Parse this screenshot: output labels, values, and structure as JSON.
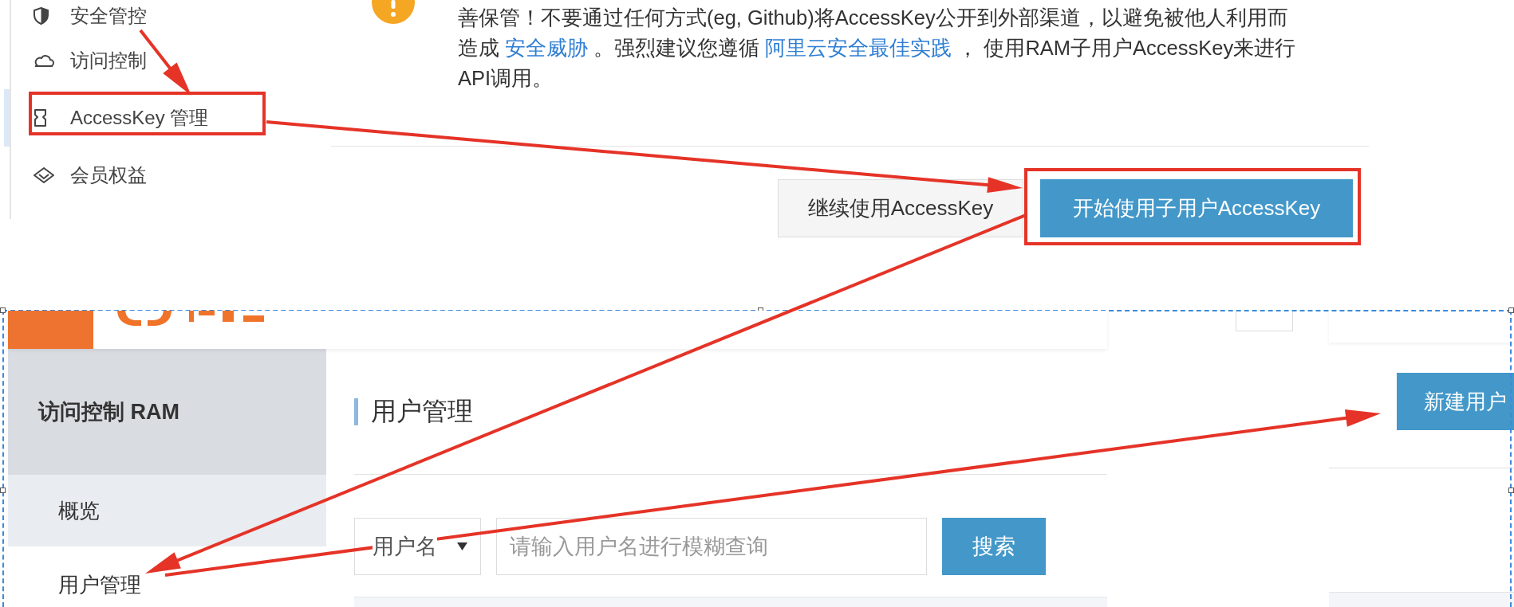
{
  "top_sidebar": {
    "items": [
      {
        "kind": "security",
        "label": "安全管控",
        "selected": false
      },
      {
        "kind": "access-control",
        "label": "访问控制",
        "selected": false
      },
      {
        "kind": "accesskey",
        "label": "AccessKey 管理",
        "selected": true
      },
      {
        "kind": "benefits",
        "label": "会员权益",
        "selected": false
      }
    ]
  },
  "notice": {
    "segments": [
      {
        "kind": "text",
        "text": "善保管！不要通过任何方式(eg, Github)将AccessKey公开到外部渠道，以避免被他人利用而造成 "
      },
      {
        "kind": "link",
        "text": "安全威胁"
      },
      {
        "kind": "text",
        "text": " 。强烈建议您遵循 "
      },
      {
        "kind": "link",
        "text": "阿里云安全最佳实践"
      },
      {
        "kind": "text",
        "text": " ， 使用RAM子用户AccessKey来进行API调用。"
      }
    ],
    "buttons": [
      {
        "kind": "default",
        "label": "继续使用AccessKey"
      },
      {
        "kind": "primary",
        "label": "开始使用子用户AccessKey"
      }
    ]
  },
  "console": {
    "sidebar": {
      "title": "访问控制 RAM",
      "items": [
        {
          "label": "概览",
          "selected": false
        },
        {
          "label": "用户管理",
          "selected": true
        }
      ]
    },
    "page_title": "用户管理",
    "search": {
      "filter": "用户名",
      "placeholder": "请输入用户名进行模糊查询",
      "button": "搜索"
    }
  },
  "side_panel": {
    "button": "新建用户"
  }
}
